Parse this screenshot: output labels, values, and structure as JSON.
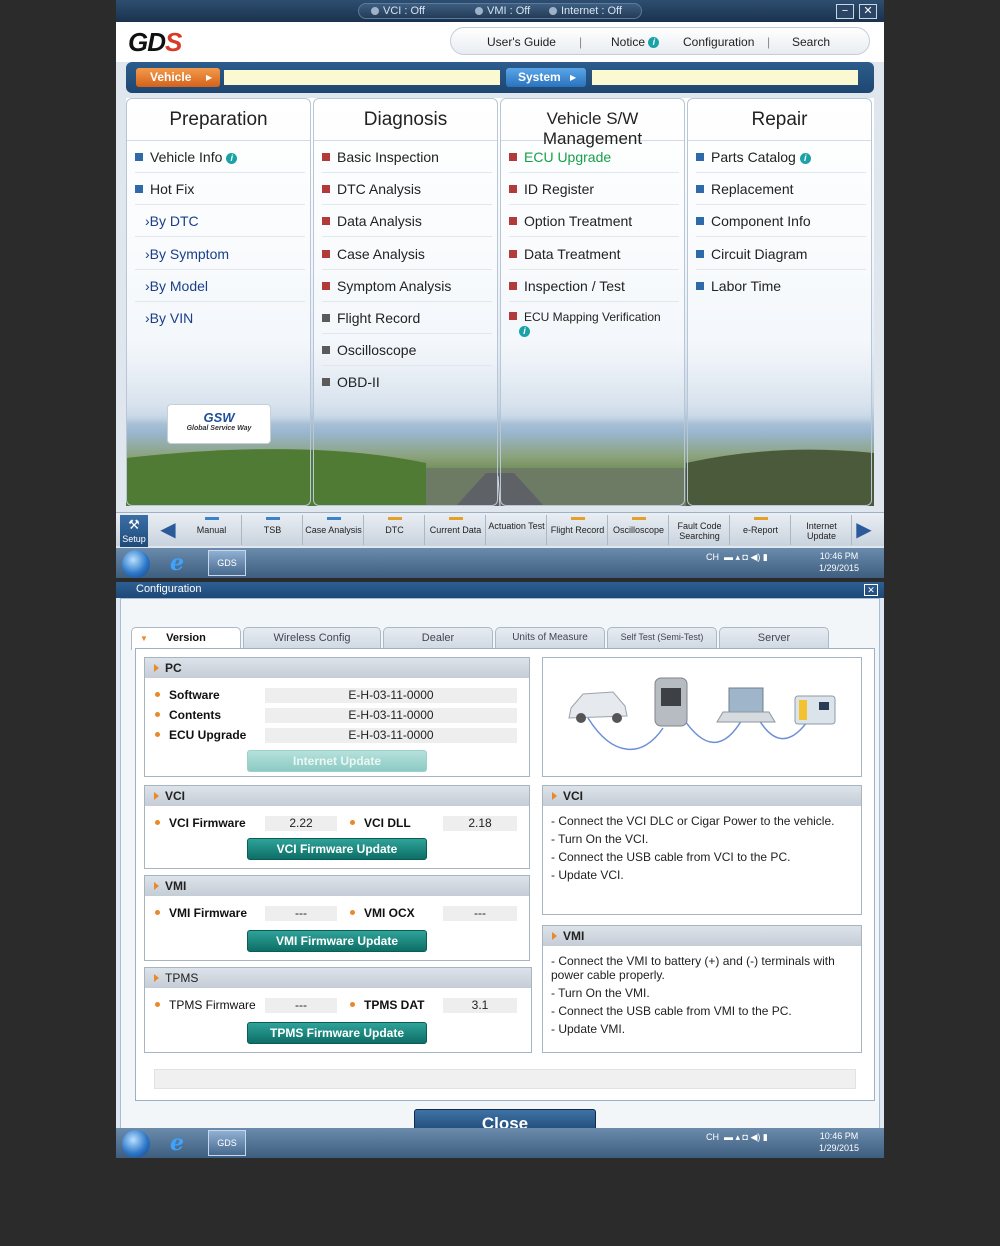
{
  "status": {
    "vci": "VCI : Off",
    "vmi": "VMI : Off",
    "internet": "Internet : Off"
  },
  "window_buttons": {
    "minimize": "−",
    "close": "✕"
  },
  "logo": {
    "main": "GD",
    "accent": "S"
  },
  "topnav": {
    "users_guide": "User's Guide",
    "sep1": "|",
    "notice": "Notice",
    "configuration": "Configuration",
    "sep2": "|",
    "search": "Search"
  },
  "tabs": {
    "vehicle": "Vehicle",
    "system": "System",
    "arrow": "▶"
  },
  "panels": {
    "preparation": {
      "title": "Preparation",
      "items": [
        "Vehicle Info",
        "Hot Fix",
        "By DTC",
        "By Symptom",
        "By Model",
        "By VIN"
      ]
    },
    "diagnosis": {
      "title": "Diagnosis",
      "items": [
        "Basic Inspection",
        "DTC Analysis",
        "Data Analysis",
        "Case Analysis",
        "Symptom Analysis",
        "Flight Record",
        "Oscilloscope",
        "OBD-II"
      ]
    },
    "swmgmt": {
      "title": "Vehicle S/W Management",
      "items": [
        "ECU Upgrade",
        "ID Register",
        "Option Treatment",
        "Data Treatment",
        "Inspection / Test",
        "ECU Mapping Verification"
      ]
    },
    "repair": {
      "title": "Repair",
      "items": [
        "Parts Catalog",
        "Replacement",
        "Component Info",
        "Circuit Diagram",
        "Labor Time"
      ]
    }
  },
  "gsw": {
    "logo": "GSW",
    "tagline": "Global Service Way"
  },
  "info_glyph": "i",
  "sub_glyph": "›",
  "toolbar": {
    "setup": "Setup",
    "setup_icon": "⚒",
    "left_arrow": "◀",
    "right_arrow": "▶",
    "buttons": [
      "Manual",
      "TSB",
      "Case Analysis",
      "DTC",
      "Current Data",
      "Actuation Test",
      "Flight Record",
      "Oscilloscope",
      "Fault Code Searching",
      "e-Report",
      "Internet Update"
    ]
  },
  "taskbar": {
    "ie": "e",
    "gds": "GDS",
    "lang": "CH",
    "tray_icons": "▬  ▴  ◘  ◀)  ▮",
    "time": "10:46 PM",
    "date": "1/29/2015"
  },
  "config": {
    "title": "Configuration",
    "close_glyph": "✕",
    "tabs": [
      "Version",
      "Wireless Config",
      "Dealer",
      "Units of Measure",
      "Self Test (Semi-Test)",
      "Server"
    ],
    "pc": {
      "header": "PC",
      "rows": [
        {
          "label": "Software",
          "value": "E-H-03-11-0000"
        },
        {
          "label": "Contents",
          "value": "E-H-03-11-0000"
        },
        {
          "label": "ECU Upgrade",
          "value": "E-H-03-11-0000"
        }
      ],
      "button": "Internet Update"
    },
    "vci": {
      "header": "VCI",
      "label1": "VCI Firmware",
      "value1": "2.22",
      "label2": "VCI DLL",
      "value2": "2.18",
      "button": "VCI Firmware Update"
    },
    "vmi": {
      "header": "VMI",
      "label1": "VMI Firmware",
      "value1": "---",
      "label2": "VMI OCX",
      "value2": "---",
      "button": "VMI Firmware Update"
    },
    "tpms": {
      "header": "TPMS",
      "label1": "TPMS Firmware",
      "value1": "---",
      "label2": "TPMS DAT",
      "value2": "3.1",
      "button": "TPMS Firmware Update"
    },
    "vci_help": {
      "header": "VCI",
      "lines": [
        "- Connect the VCI DLC or Cigar Power to the vehicle.",
        "- Turn On the VCI.",
        "- Connect the USB cable from VCI to the PC.",
        "- Update VCI."
      ]
    },
    "vmi_help": {
      "header": "VMI",
      "lines": [
        "- Connect the VMI to battery (+) and (-) terminals with power cable properly.",
        "- Turn On the VMI.",
        "- Connect the USB cable from VMI to the PC.",
        "- Update VMI."
      ]
    },
    "close": "Close"
  },
  "colors": {
    "accent_orange": "#e8892a",
    "teal_button": "#0d6e66",
    "nav_blue": "#1e4670",
    "ecu_green": "#16a04a"
  }
}
